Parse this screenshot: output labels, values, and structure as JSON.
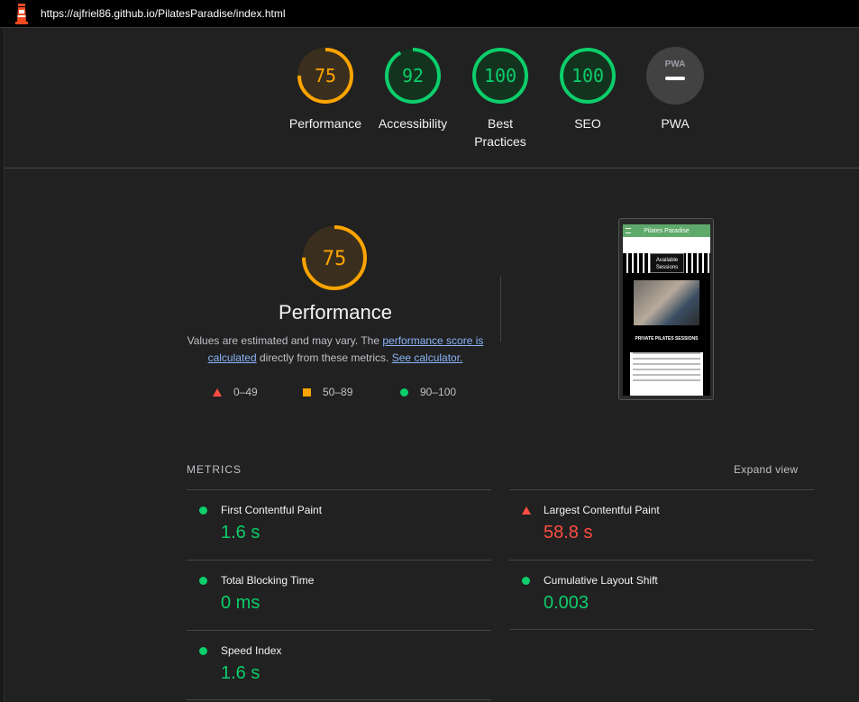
{
  "url": "https://ajfriel86.github.io/PilatesParadise/index.html",
  "colors": {
    "pass": "#0cce6b",
    "average": "#ffa400",
    "fail": "#ff4e42",
    "link": "#8ab4f8"
  },
  "summary": [
    {
      "label": "Performance",
      "score": "75",
      "value": 0.75,
      "rating": "average"
    },
    {
      "label": "Accessibility",
      "score": "92",
      "value": 0.92,
      "rating": "pass"
    },
    {
      "label": "Best Practices",
      "score": "100",
      "value": 1.0,
      "rating": "pass"
    },
    {
      "label": "SEO",
      "score": "100",
      "value": 1.0,
      "rating": "pass"
    },
    {
      "label": "PWA",
      "score": "",
      "rating": "na"
    }
  ],
  "pwa_badge": "PWA",
  "performance": {
    "score": "75",
    "title": "Performance",
    "desc_prefix": "Values are estimated and may vary. The ",
    "link_score": "performance score is calculated",
    "desc_middle": " directly from these metrics. ",
    "link_calc": "See calculator.",
    "legend": [
      {
        "range": "0–49",
        "shape": "triangle-icon"
      },
      {
        "range": "50–89",
        "shape": "square-icon"
      },
      {
        "range": "90–100",
        "shape": "circle-icon"
      }
    ]
  },
  "thumbnail": {
    "site_title": "Pilates Paradise",
    "badge": "Available Sessions",
    "subheading": "PRIVATE PILATES SESSIONS"
  },
  "metrics": {
    "heading": "METRICS",
    "expand_label": "Expand view",
    "items": [
      {
        "title": "First Contentful Paint",
        "value": "1.6 s",
        "rating": "pass"
      },
      {
        "title": "Largest Contentful Paint",
        "value": "58.8 s",
        "rating": "fail"
      },
      {
        "title": "Total Blocking Time",
        "value": "0 ms",
        "rating": "pass"
      },
      {
        "title": "Cumulative Layout Shift",
        "value": "0.003",
        "rating": "pass"
      },
      {
        "title": "Speed Index",
        "value": "1.6 s",
        "rating": "pass"
      }
    ]
  }
}
